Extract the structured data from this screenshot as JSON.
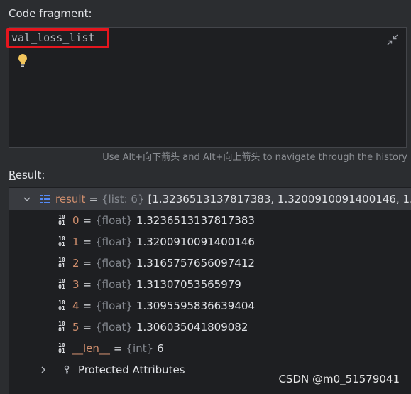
{
  "labels": {
    "code_fragment": "Code fragment:",
    "result_mnemonic": "R",
    "result_rest": "esult:"
  },
  "editor": {
    "code": "val_loss_list",
    "hint": "Use Alt+向下箭头 and Alt+向上箭头 to navigate through the history"
  },
  "tree": {
    "root": {
      "name": "result",
      "eq": "=",
      "type": "{list: 6}",
      "value": "[1.3236513137817383, 1.3200910091400146, 1.3"
    },
    "items": [
      {
        "name": "0",
        "eq": "=",
        "type": "{float}",
        "value": "1.3236513137817383"
      },
      {
        "name": "1",
        "eq": "=",
        "type": "{float}",
        "value": "1.3200910091400146"
      },
      {
        "name": "2",
        "eq": "=",
        "type": "{float}",
        "value": "1.3165757656097412"
      },
      {
        "name": "3",
        "eq": "=",
        "type": "{float}",
        "value": "1.31307053565979"
      },
      {
        "name": "4",
        "eq": "=",
        "type": "{float}",
        "value": "1.3095595836639404"
      },
      {
        "name": "5",
        "eq": "=",
        "type": "{float}",
        "value": "1.306035041809082"
      },
      {
        "name": "__len__",
        "eq": "=",
        "type": "{int}",
        "value": "6"
      }
    ],
    "protected": "Protected Attributes",
    "num_icon_top": "10",
    "num_icon_bottom": "01"
  },
  "watermark": "CSDN @m0_51579041",
  "icons": {
    "collapse": "collapse-icon",
    "bulb": "lightbulb-icon",
    "expand": "chevron-down-icon",
    "collapsed": "chevron-right-icon",
    "list": "list-icon",
    "number": "number-icon",
    "key": "key-icon"
  },
  "colors": {
    "background": "#2b2d30",
    "editor_background": "#1e1f22",
    "highlight_border": "#e5161e",
    "variable_name": "#cf8e6d",
    "type_text": "#868a91",
    "selected_row": "#393b40"
  }
}
